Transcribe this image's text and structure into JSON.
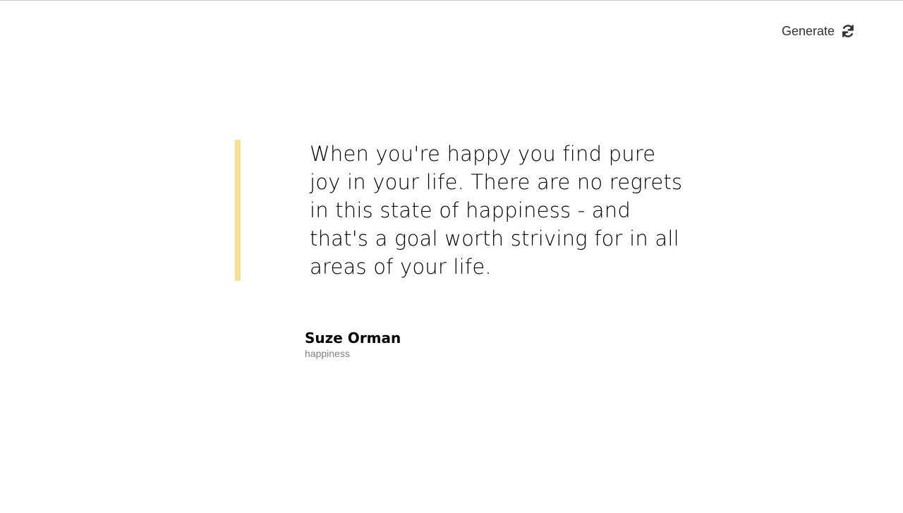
{
  "header": {
    "generate_label": "Generate",
    "generate_icon": "refresh-icon"
  },
  "quote": {
    "text": "When you're happy you find pure joy in your life. There are no regrets in this state of happiness - and that's a goal worth striving for in all areas of your life.",
    "author": "Suze Orman",
    "genre": "happiness",
    "accent_color": "#f7df94"
  }
}
